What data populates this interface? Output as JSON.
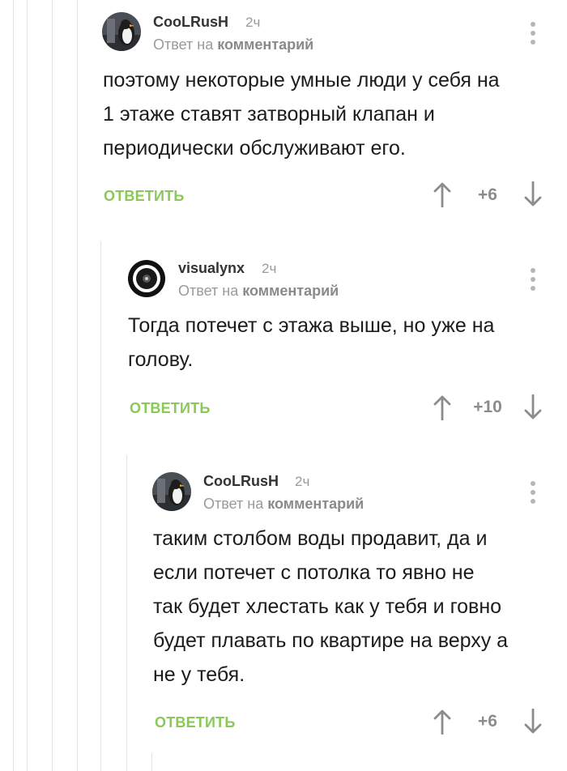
{
  "comments": [
    {
      "author": "CooLRusH",
      "time": "2ч",
      "reply_prefix": "Ответ на",
      "reply_link": "комментарий",
      "text": "поэтому некоторые умные люди у себя на\n1 этаже ставят затворный клапан и\nпериодически обслуживают его.",
      "reply_label": "ОТВЕТИТЬ",
      "rating": "+6",
      "avatar": "penguin-avatar"
    },
    {
      "author": "visualynx",
      "time": "2ч",
      "reply_prefix": "Ответ на",
      "reply_link": "комментарий",
      "text": "Тогда потечет с этажа выше, но уже на\nголову.",
      "reply_label": "ОТВЕТИТЬ",
      "rating": "+10",
      "avatar": "speaker-avatar"
    },
    {
      "author": "CooLRusH",
      "time": "2ч",
      "reply_prefix": "Ответ на",
      "reply_link": "комментарий",
      "text": "таким столбом воды продавит, да и\nесли потечет с потолка то явно не\nтак будет хлестать как у тебя и говно\nбудет плавать по квартире на верху а\nне у тебя.",
      "reply_label": "ОТВЕТИТЬ",
      "rating": "+6",
      "avatar": "penguin-avatar"
    }
  ],
  "colors": {
    "reply_green": "#8ac858",
    "thread_line": "#e3e3e3",
    "muted_text": "#9a9a9a"
  }
}
